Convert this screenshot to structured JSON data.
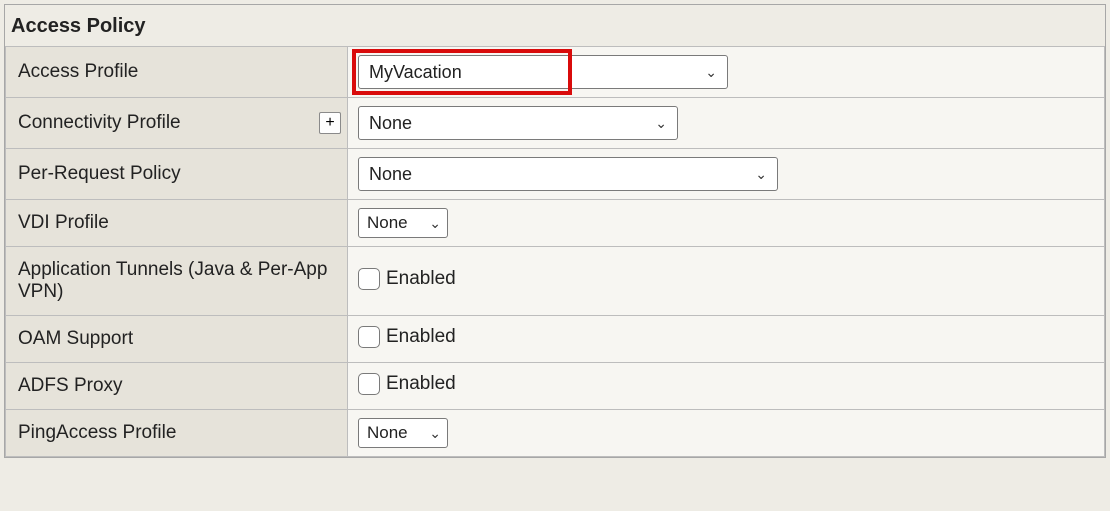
{
  "panel": {
    "title": "Access Policy"
  },
  "rows": {
    "access_profile": {
      "label": "Access Profile",
      "value": "MyVacation"
    },
    "connectivity": {
      "label": "Connectivity Profile",
      "value": "None",
      "add": "+"
    },
    "per_request": {
      "label": "Per-Request Policy",
      "value": "None"
    },
    "vdi": {
      "label": "VDI Profile",
      "value": "None"
    },
    "app_tunnels": {
      "label": "Application Tunnels (Java & Per-App VPN)",
      "check_label": "Enabled"
    },
    "oam": {
      "label": "OAM Support",
      "check_label": "Enabled"
    },
    "adfs": {
      "label": "ADFS Proxy",
      "check_label": "Enabled"
    },
    "pingaccess": {
      "label": "PingAccess Profile",
      "value": "None"
    }
  }
}
